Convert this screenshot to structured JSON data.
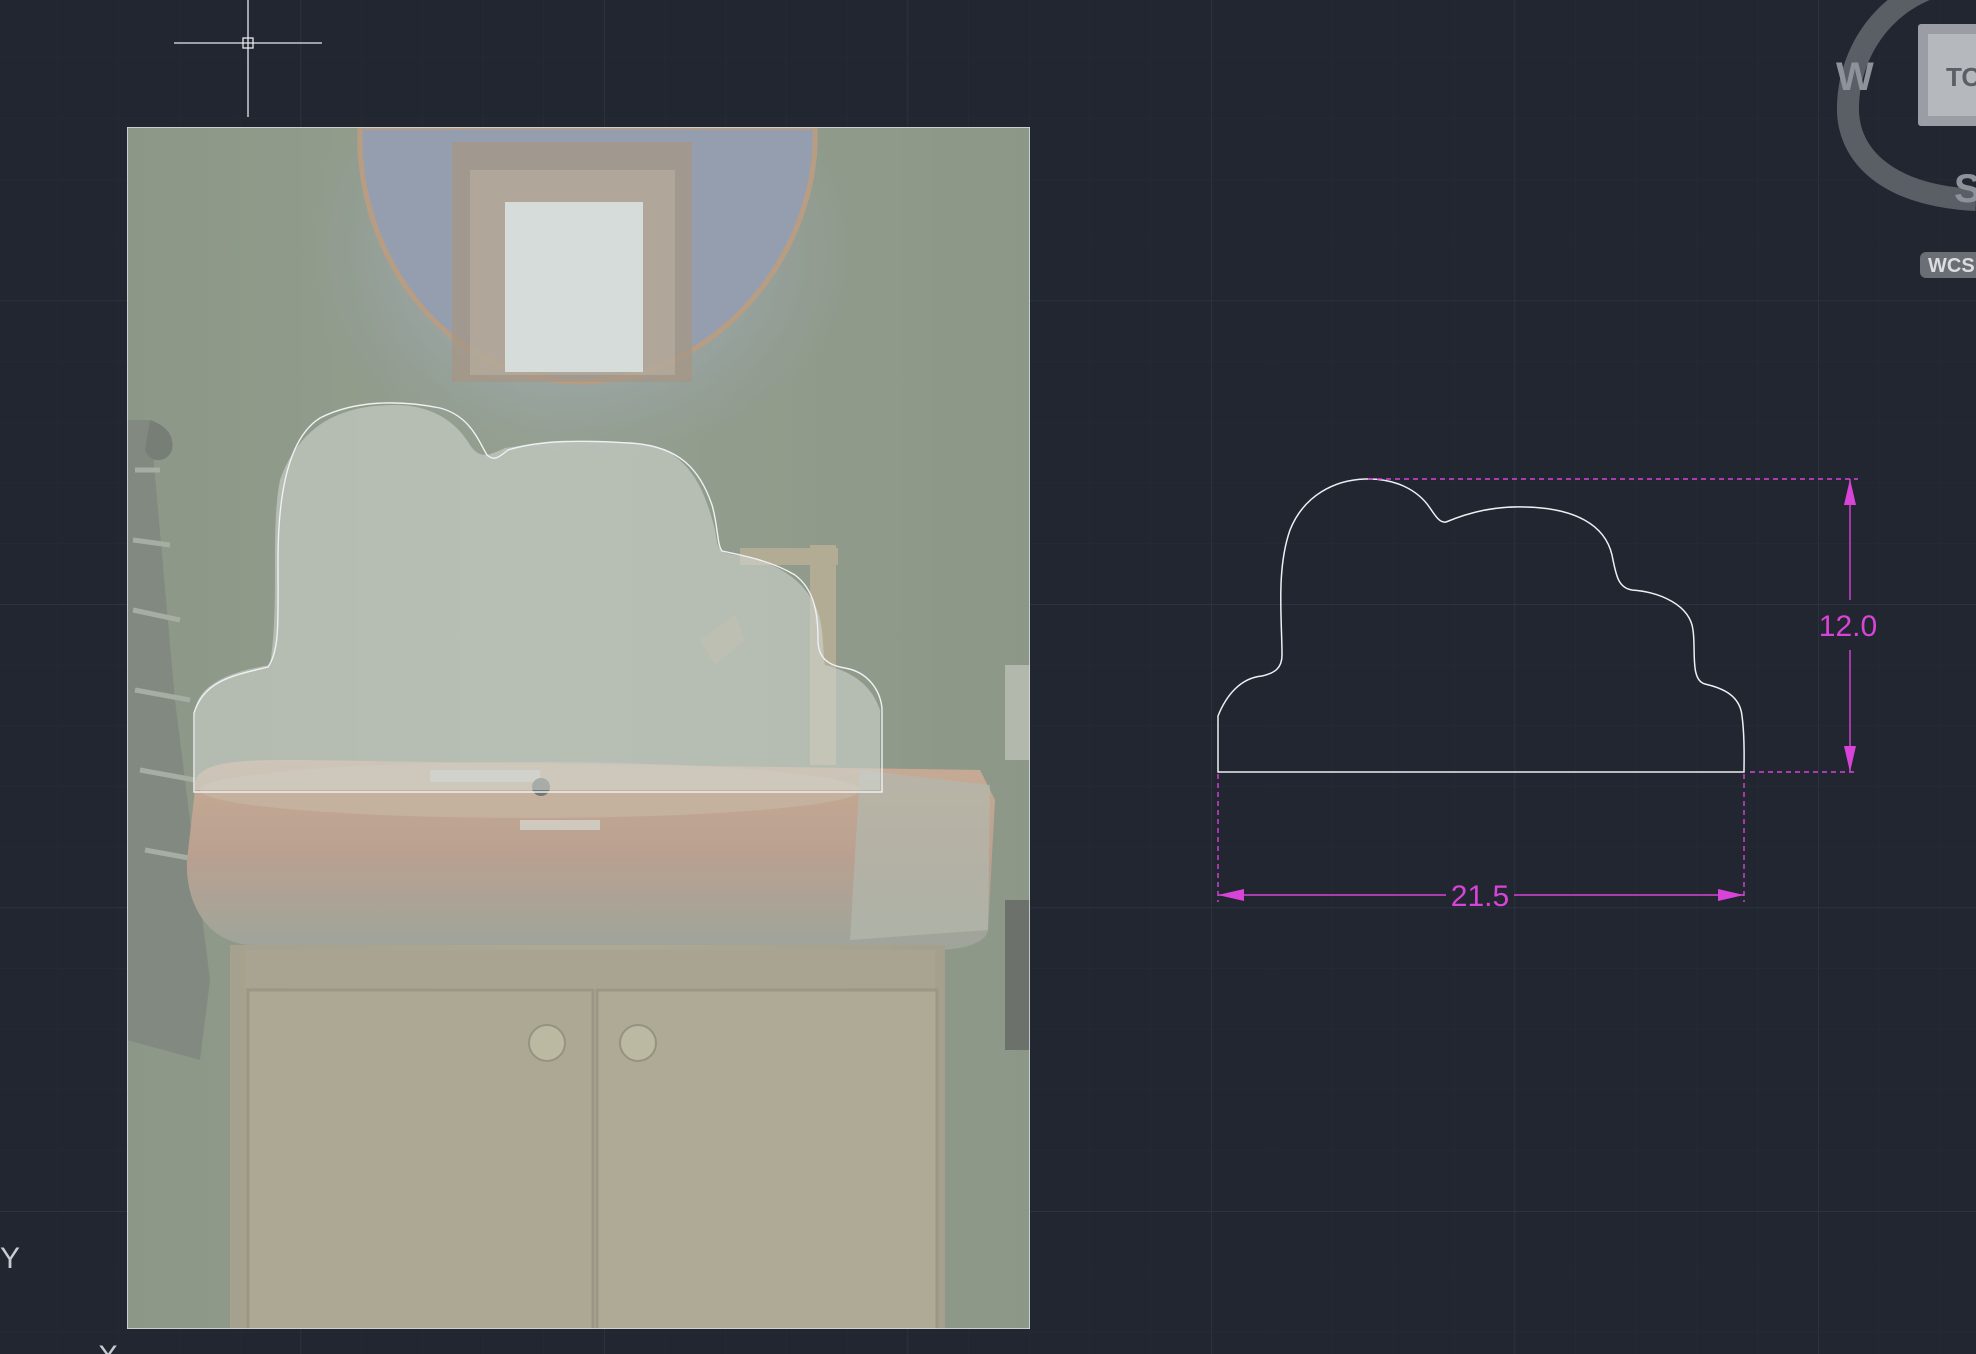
{
  "viewcube": {
    "west_label": "W",
    "south_label": "S",
    "face_label": "TO",
    "ucs_label": "WCS"
  },
  "ucs_icon": {
    "y_label": "Y",
    "x_label": "X"
  },
  "dimensions": {
    "width_value": "21.5",
    "height_value": "12.0"
  },
  "colors": {
    "background": "#212630",
    "grid_minor": "#262c37",
    "grid_major": "#2e3542",
    "geometry": "#e8eaee",
    "dimension": "#d844d8",
    "viewcube": "#8e939b"
  },
  "reference_image": {
    "icon": "bathroom-photo"
  }
}
